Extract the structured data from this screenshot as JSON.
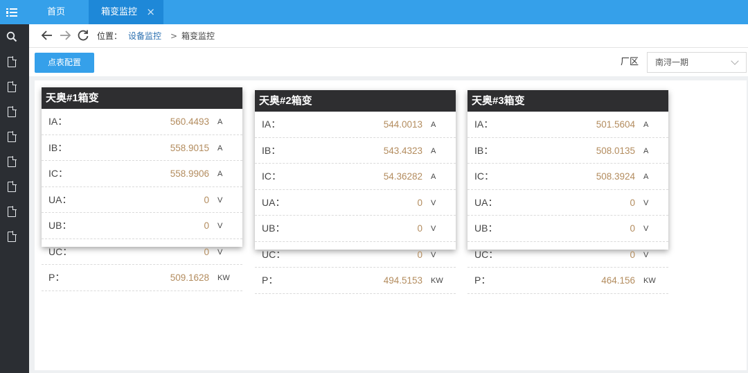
{
  "tabs": {
    "home_label": "首页",
    "active_label": "箱变监控",
    "close_glyph": "×"
  },
  "breadcrumb": {
    "prefix": "位置：",
    "parent": "设备监控",
    "separator": ">",
    "current": "箱变监控"
  },
  "toolbar": {
    "config_button": "点表配置",
    "area_label": "厂区",
    "area_selected": "南浔一期"
  },
  "colors": {
    "accent": "#35a0ea",
    "tab_active": "#1e88d8",
    "sidebar": "#2b2e33",
    "card_header": "#2e2e30",
    "value": "#b38c5e"
  },
  "sidebar": {
    "icons": [
      "menu-icon",
      "search-icon",
      "document-icon",
      "document-icon",
      "document-icon",
      "document-icon",
      "document-icon",
      "document-icon",
      "document-icon",
      "document-icon"
    ]
  },
  "cards": [
    {
      "title": "天奥#1箱变",
      "rows": [
        {
          "label": "IA：",
          "value": "560.4493",
          "unit": "A"
        },
        {
          "label": "IB：",
          "value": "558.9015",
          "unit": "A"
        },
        {
          "label": "IC：",
          "value": "558.9906",
          "unit": "A"
        },
        {
          "label": "UA：",
          "value": "0",
          "unit": "V"
        },
        {
          "label": "UB：",
          "value": "0",
          "unit": "V"
        },
        {
          "label": "UC：",
          "value": "0",
          "unit": "V"
        },
        {
          "label": "P：",
          "value": "509.1628",
          "unit": "KW"
        }
      ]
    },
    {
      "title": "天奥#2箱变",
      "rows": [
        {
          "label": "IA：",
          "value": "544.0013",
          "unit": "A"
        },
        {
          "label": "IB：",
          "value": "543.4323",
          "unit": "A"
        },
        {
          "label": "IC：",
          "value": "54.36282",
          "unit": "A"
        },
        {
          "label": "UA：",
          "value": "0",
          "unit": "V"
        },
        {
          "label": "UB：",
          "value": "0",
          "unit": "V"
        },
        {
          "label": "UC：",
          "value": "0",
          "unit": "V"
        },
        {
          "label": "P：",
          "value": "494.5153",
          "unit": "KW"
        }
      ]
    },
    {
      "title": "天奥#3箱变",
      "rows": [
        {
          "label": "IA：",
          "value": "501.5604",
          "unit": "A"
        },
        {
          "label": "IB：",
          "value": "508.0135",
          "unit": "A"
        },
        {
          "label": "IC：",
          "value": "508.3924",
          "unit": "A"
        },
        {
          "label": "UA：",
          "value": "0",
          "unit": "V"
        },
        {
          "label": "UB：",
          "value": "0",
          "unit": "V"
        },
        {
          "label": "UC：",
          "value": "0",
          "unit": "V"
        },
        {
          "label": "P：",
          "value": "464.156",
          "unit": "KW"
        }
      ]
    }
  ]
}
